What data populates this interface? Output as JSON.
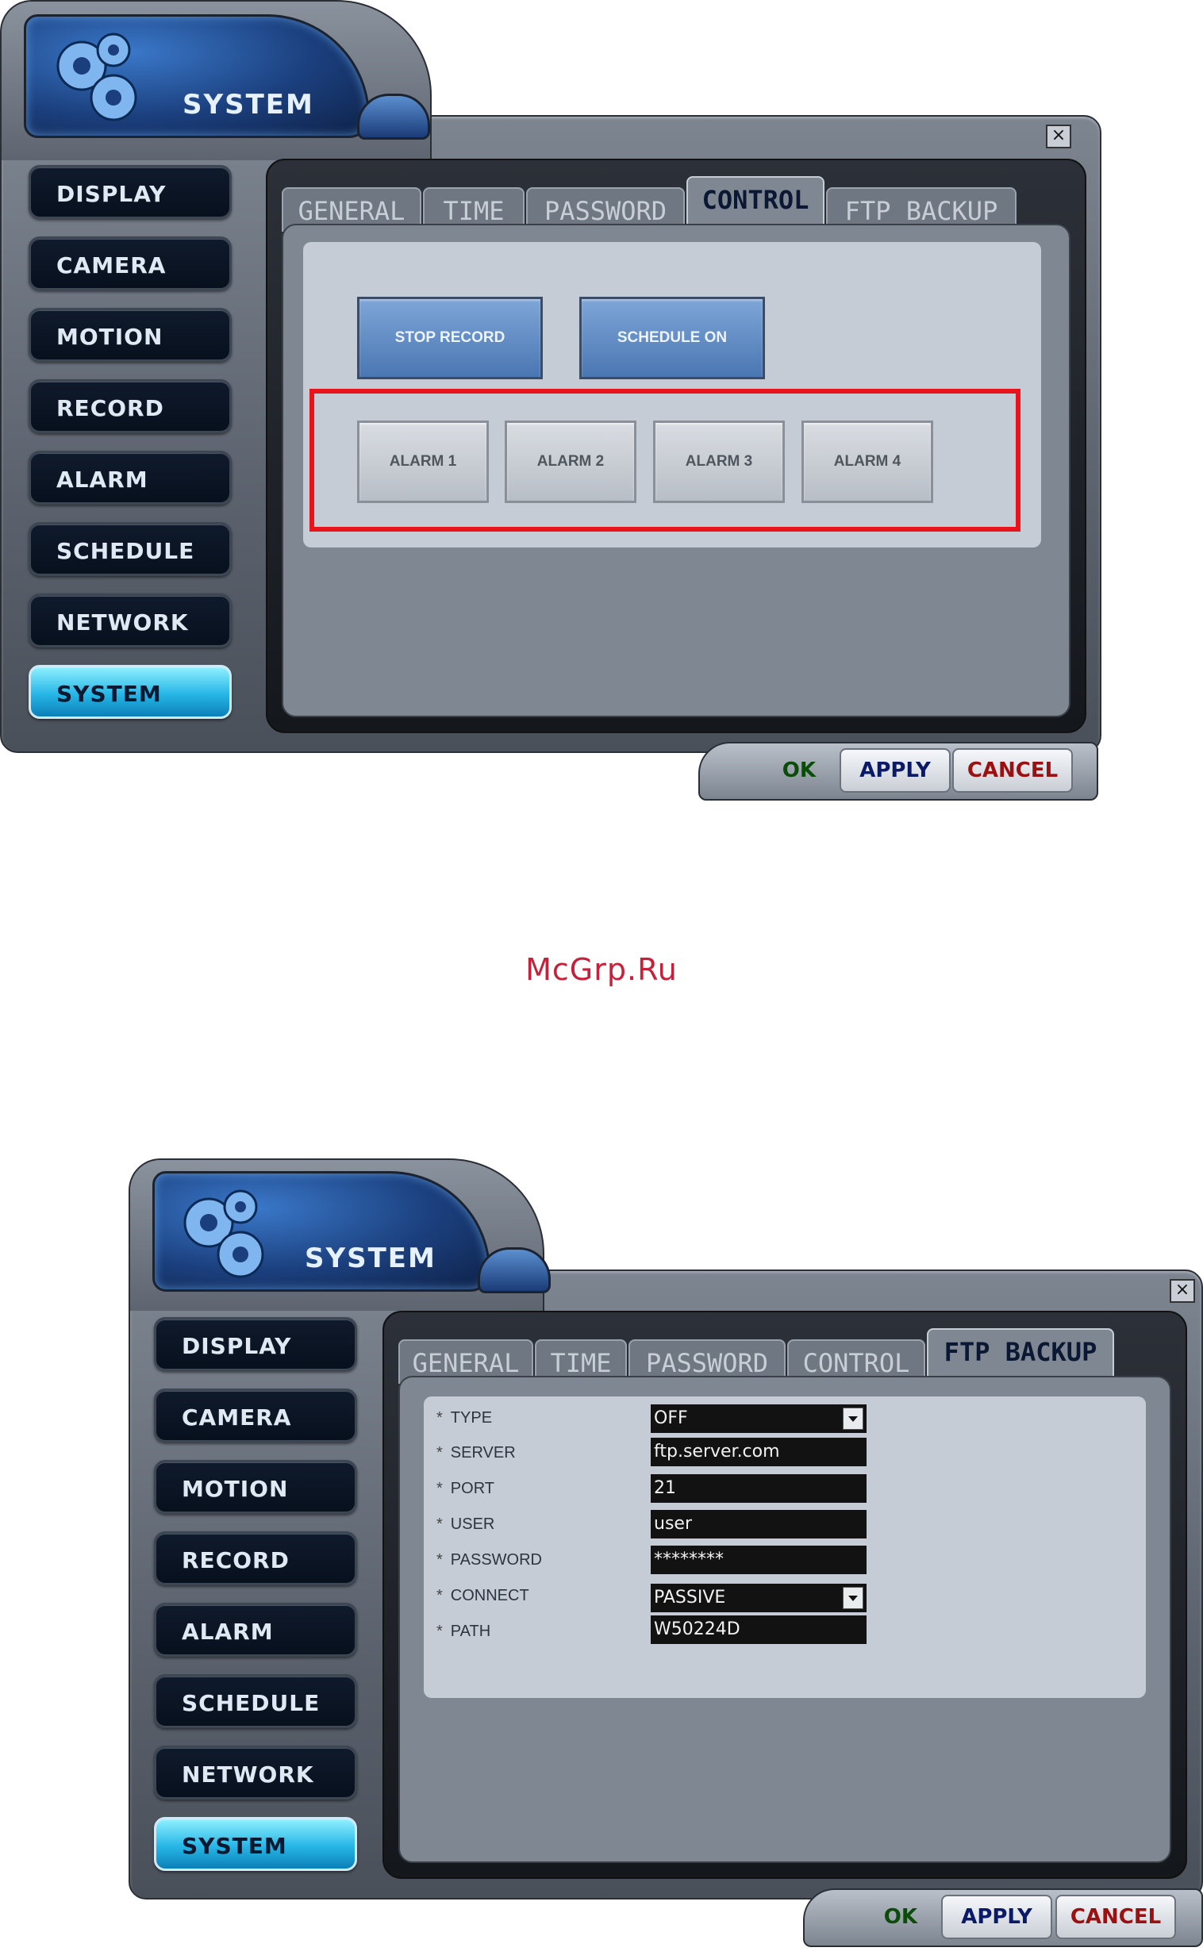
{
  "watermark": "McGrp.Ru",
  "dialog1": {
    "title": "SYSTEM",
    "close": "×",
    "nav": [
      "DISPLAY",
      "CAMERA",
      "MOTION",
      "RECORD",
      "ALARM",
      "SCHEDULE",
      "NETWORK",
      "SYSTEM"
    ],
    "active_nav": "SYSTEM",
    "tabs": [
      "GENERAL",
      "TIME",
      "PASSWORD",
      "CONTROL",
      "FTP BACKUP"
    ],
    "active_tab": "CONTROL",
    "buttons": {
      "stop_record": "STOP RECORD",
      "schedule_on": "SCHEDULE ON"
    },
    "alarms": [
      "ALARM 1",
      "ALARM 2",
      "ALARM 3",
      "ALARM 4"
    ],
    "footer": {
      "ok": "OK",
      "apply": "APPLY",
      "cancel": "CANCEL"
    }
  },
  "dialog2": {
    "title": "SYSTEM",
    "close": "×",
    "nav": [
      "DISPLAY",
      "CAMERA",
      "MOTION",
      "RECORD",
      "ALARM",
      "SCHEDULE",
      "NETWORK",
      "SYSTEM"
    ],
    "active_nav": "SYSTEM",
    "tabs": [
      "GENERAL",
      "TIME",
      "PASSWORD",
      "CONTROL",
      "FTP BACKUP"
    ],
    "active_tab": "FTP BACKUP",
    "ftp": {
      "type_label": "TYPE",
      "type_value": "OFF",
      "server_label": "SERVER",
      "server_value": "ftp.server.com",
      "port_label": "PORT",
      "port_value": "21",
      "user_label": "USER",
      "user_value": "user",
      "password_label": "PASSWORD",
      "password_value": "********",
      "connect_label": "CONNECT",
      "connect_value": "PASSIVE",
      "path_label": "PATH",
      "path_value": "W50224D"
    },
    "footer": {
      "ok": "OK",
      "apply": "APPLY",
      "cancel": "CANCEL"
    }
  },
  "colors": {
    "highlight": "#e8131b",
    "active_nav": "#26b6e6",
    "ok": "#0a4c08",
    "apply": "#0a1a66",
    "cancel": "#9b1010"
  }
}
